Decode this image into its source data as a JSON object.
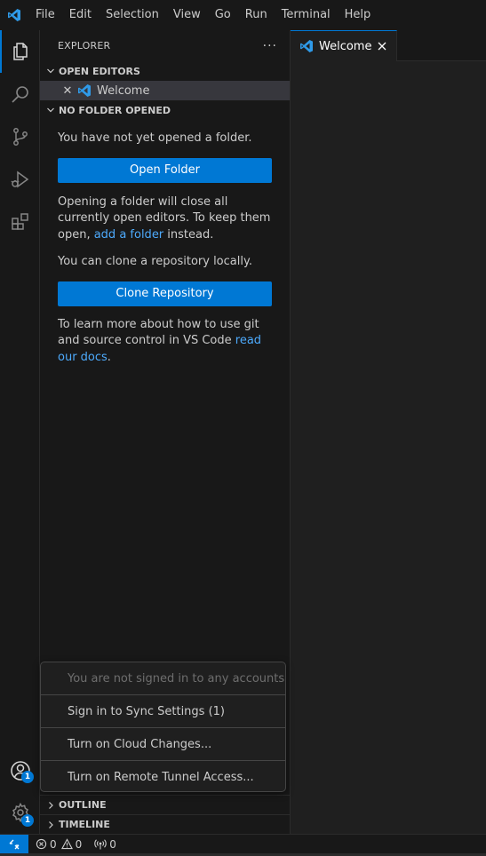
{
  "menubar": {
    "items": [
      "File",
      "Edit",
      "Selection",
      "View",
      "Go",
      "Run",
      "Terminal",
      "Help"
    ]
  },
  "activitybar": {
    "accounts_badge": "1",
    "manage_badge": "1"
  },
  "sidebar": {
    "title": "EXPLORER",
    "open_editors_label": "OPEN EDITORS",
    "open_editor_item": "Welcome",
    "no_folder_label": "NO FOLDER OPENED",
    "msg_no_folder": "You have not yet opened a folder.",
    "open_folder_btn": "Open Folder",
    "msg_opening_part1": "Opening a folder will close all currently open editors. To keep them open, ",
    "msg_opening_link": "add a folder",
    "msg_opening_part2": " instead.",
    "msg_clone": "You can clone a repository locally.",
    "clone_btn": "Clone Repository",
    "msg_learn_part1": "To learn more about how to use git and source control in VS Code ",
    "msg_learn_link": "read our docs",
    "msg_learn_part2": ".",
    "outline_label": "OUTLINE",
    "timeline_label": "TIMELINE"
  },
  "editor": {
    "tab_label": "Welcome"
  },
  "accounts_menu": {
    "items": [
      "You are not signed in to any accounts",
      "Sign in to Sync Settings (1)",
      "Turn on Cloud Changes...",
      "Turn on Remote Tunnel Access..."
    ]
  },
  "statusbar": {
    "errors": "0",
    "warnings": "0",
    "ports": "0"
  },
  "colors": {
    "accent": "#0078d4",
    "link": "#4daafc",
    "vscode_logo": "#2f9ae8"
  }
}
